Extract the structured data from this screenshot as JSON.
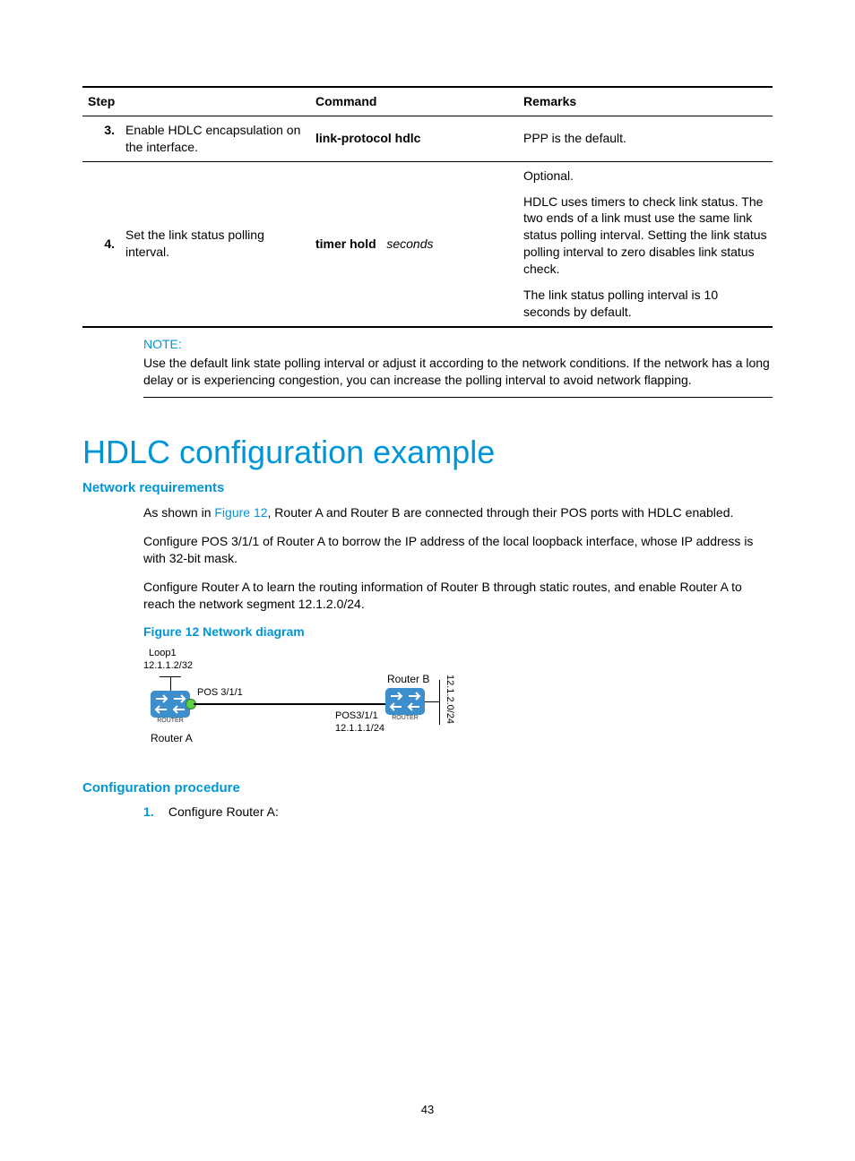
{
  "table": {
    "headers": {
      "step": "Step",
      "command": "Command",
      "remarks": "Remarks"
    },
    "rows": [
      {
        "num": "3.",
        "step": "Enable HDLC encapsulation on the interface.",
        "cmd_bold": "link-protocol hdlc",
        "cmd_italic": "",
        "remarks": [
          "PPP is the default."
        ]
      },
      {
        "num": "4.",
        "step": "Set the link status polling interval.",
        "cmd_bold": "timer hold",
        "cmd_italic": "seconds",
        "remarks": [
          "Optional.",
          "HDLC uses timers to check link status. The two ends of a link must use the same link status polling interval. Setting the link status polling interval to zero disables link status check.",
          "The link status polling interval is 10 seconds by default."
        ]
      }
    ]
  },
  "note": {
    "label": "NOTE:",
    "body": "Use the default link state polling interval or adjust it according to the network conditions. If the network has a long delay or is experiencing congestion, you can increase the polling interval to avoid network flapping."
  },
  "h1": "HDLC configuration example",
  "netreq": {
    "heading": "Network requirements",
    "p1a": "As shown in ",
    "p1link": "Figure 12",
    "p1b": ", Router A and Router B are connected through their POS ports with HDLC enabled.",
    "p2": "Configure POS 3/1/1 of Router A to borrow the IP address of the local loopback interface, whose IP address is with 32-bit mask.",
    "p3": "Configure Router A to learn the routing information of Router B through static routes, and enable Router A to reach the network segment 12.1.2.0/24."
  },
  "figure": {
    "caption": "Figure 12 Network diagram",
    "loop_label": "Loop1",
    "loop_ip": "12.1.1.2/32",
    "routerA_name": "Router A",
    "routerA_port": "POS 3/1/1",
    "routerB_name": "Router B",
    "routerB_port": "POS3/1/1",
    "routerB_ip": "12.1.1.1/24",
    "right_net": "12.1.2.0/24",
    "router_badge": "ROUTER"
  },
  "configproc": {
    "heading": "Configuration procedure",
    "s1num": "1.",
    "s1text": "Configure Router A:"
  },
  "page_number": "43"
}
